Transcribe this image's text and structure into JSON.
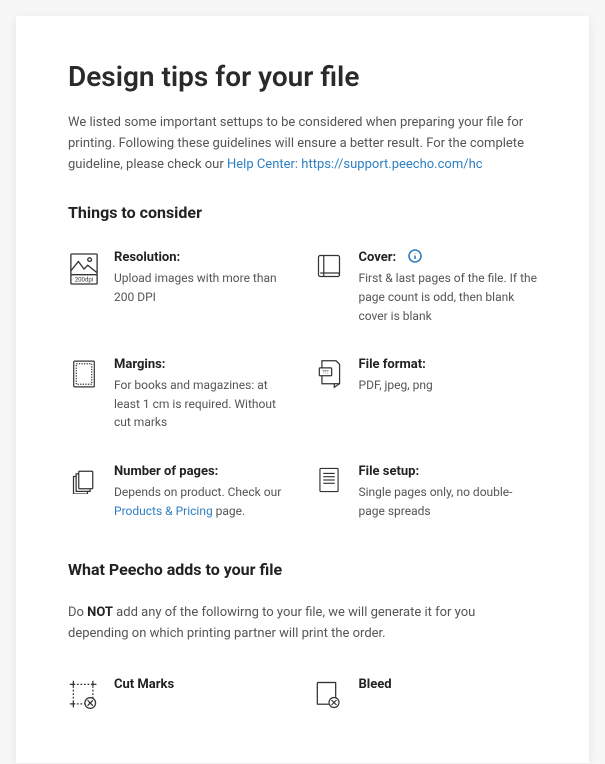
{
  "title": "Design tips for your file",
  "intro_prefix": "We listed some important settups to be considered when preparing your file for printing. Following these guidelines will ensure a better result. For the complete guideline, please check our ",
  "intro_link": "Help Center: https://support.peecho.com/hc",
  "section1_title": "Things to consider",
  "items": {
    "resolution": {
      "title": "Resolution:",
      "desc": "Upload images with more than 200 DPI"
    },
    "cover": {
      "title": "Cover:",
      "desc": "First & last pages of the file. If the page count is odd, then blank cover is blank"
    },
    "margins": {
      "title": "Margins:",
      "desc": "For books and magazines: at least 1 cm is required. Without cut marks"
    },
    "fileformat": {
      "title": "File format:",
      "desc": "PDF, jpeg, png"
    },
    "pages": {
      "title": "Number of pages:",
      "desc_prefix": "Depends on product. Check our ",
      "desc_link": "Products & Pricing",
      "desc_suffix": " page."
    },
    "setup": {
      "title": "File setup:",
      "desc": "Single pages only, no double-page spreads"
    }
  },
  "section2_title": "What Peecho adds to your file",
  "note_prefix": "Do ",
  "note_strong": "NOT",
  "note_suffix": " add any of the followirng to your file, we will generate it for you depending on which printing partner will print the order.",
  "adds": {
    "cutmarks": {
      "title": "Cut Marks"
    },
    "bleed": {
      "title": "Bleed"
    }
  }
}
